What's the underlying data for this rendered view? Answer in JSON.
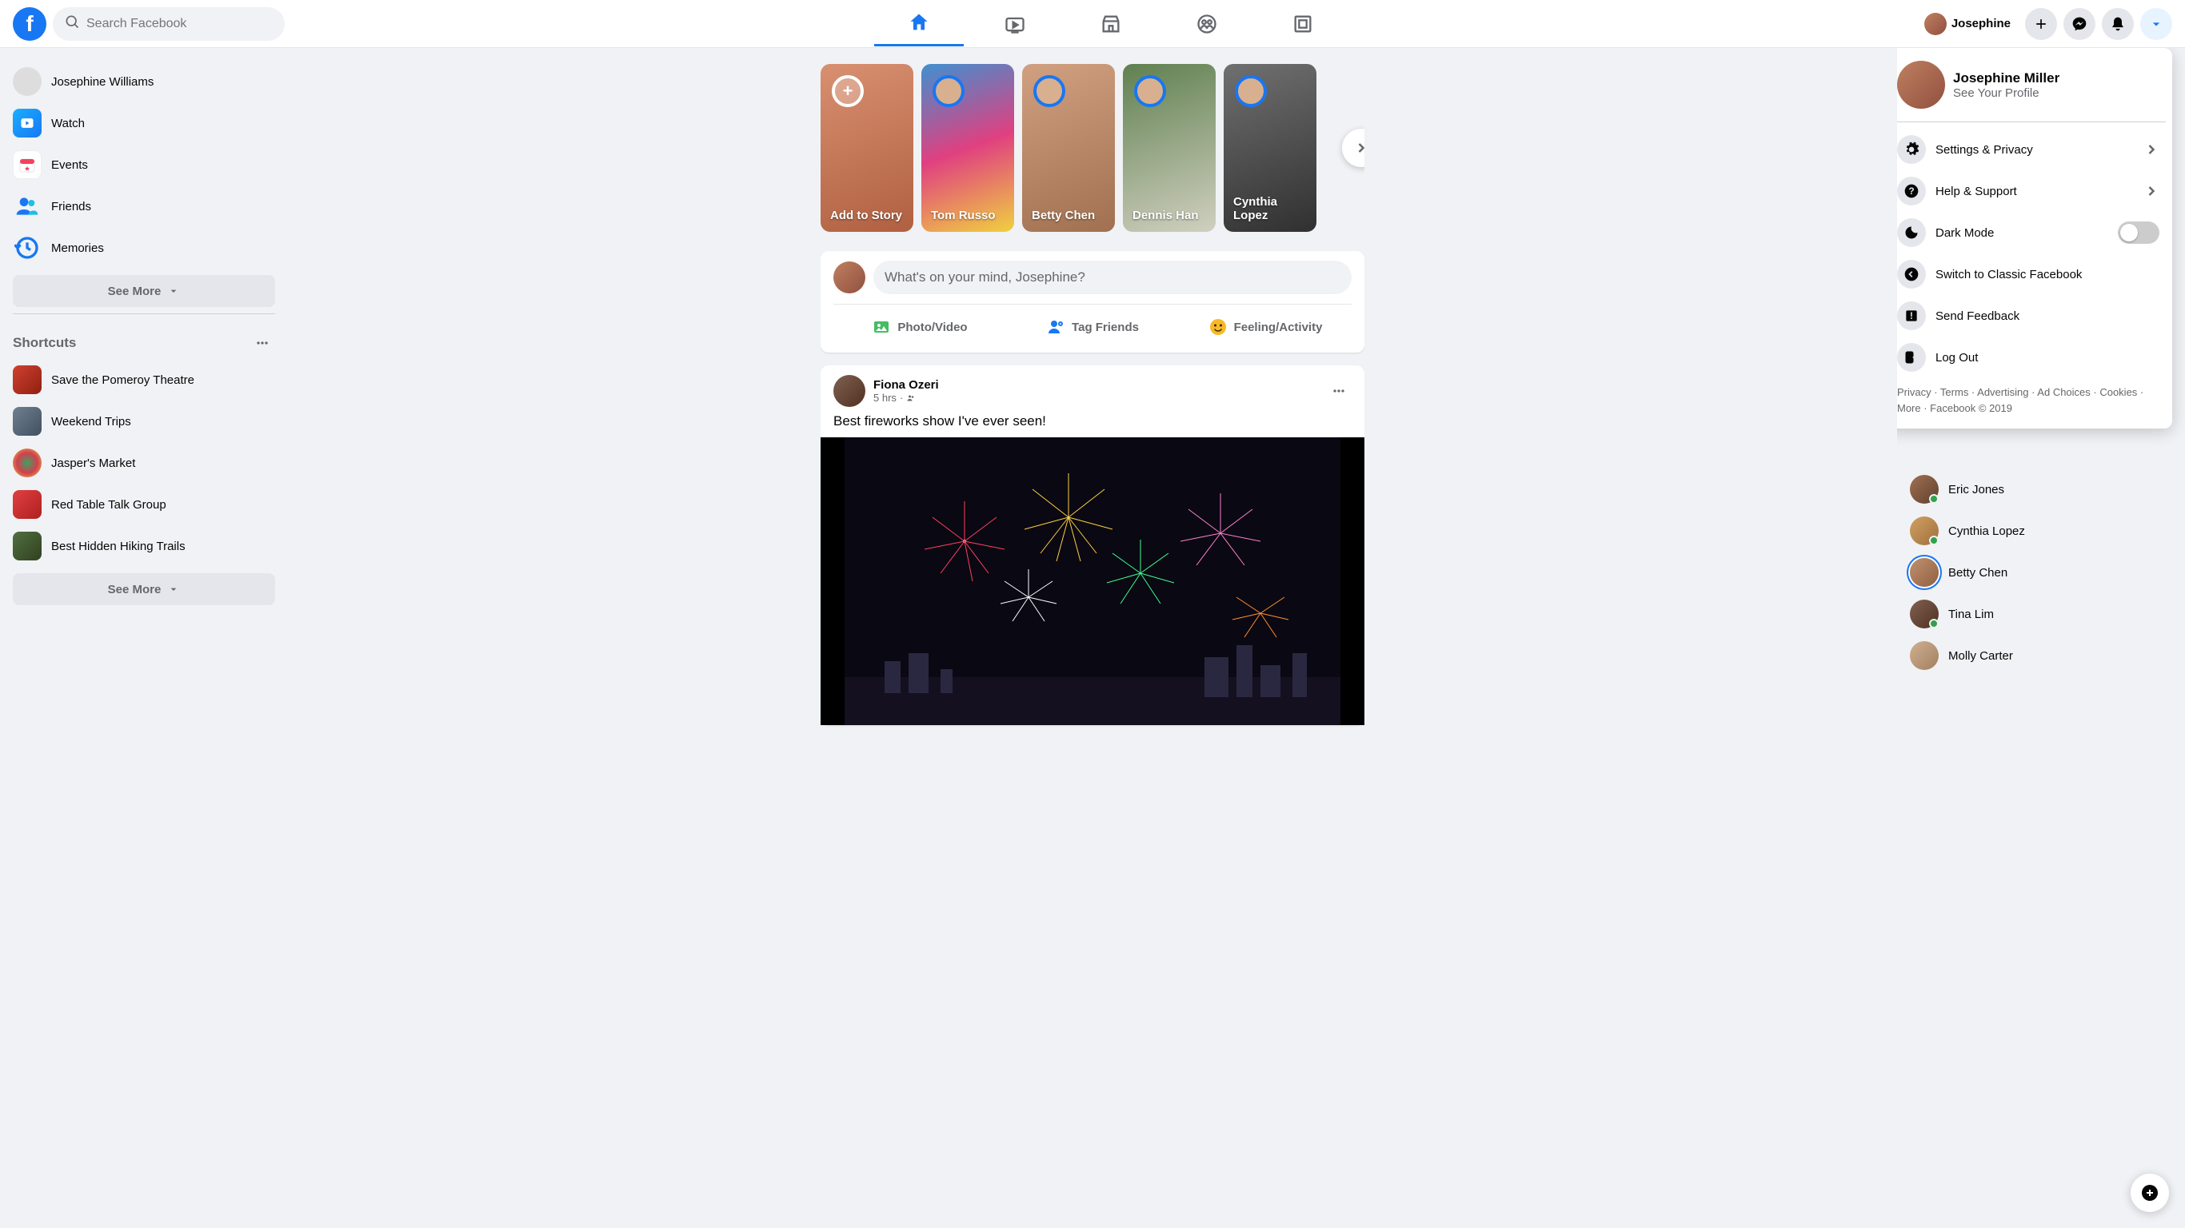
{
  "header": {
    "search_placeholder": "Search Facebook",
    "profile_name": "Josephine"
  },
  "left_sidebar": {
    "user_name": "Josephine Williams",
    "items": [
      {
        "label": "Watch"
      },
      {
        "label": "Events"
      },
      {
        "label": "Friends"
      },
      {
        "label": "Memories"
      }
    ],
    "see_more": "See More",
    "shortcuts_title": "Shortcuts",
    "shortcuts": [
      {
        "label": "Save the Pomeroy Theatre"
      },
      {
        "label": "Weekend Trips"
      },
      {
        "label": "Jasper's Market"
      },
      {
        "label": "Red Table Talk Group"
      },
      {
        "label": "Best Hidden Hiking Trails"
      }
    ],
    "see_more_2": "See More"
  },
  "stories": {
    "create_label": "Add to Story",
    "items": [
      {
        "name": "Tom Russo"
      },
      {
        "name": "Betty Chen"
      },
      {
        "name": "Dennis Han"
      },
      {
        "name": "Cynthia Lopez"
      }
    ]
  },
  "composer": {
    "placeholder": "What's on your mind, Josephine?",
    "photo_video": "Photo/Video",
    "tag_friends": "Tag Friends",
    "feeling_activity": "Feeling/Activity"
  },
  "post": {
    "author": "Fiona Ozeri",
    "time": "5 hrs",
    "body": "Best fireworks show I've ever seen!"
  },
  "dropdown": {
    "profile_name": "Josephine Miller",
    "profile_sub": "See Your Profile",
    "settings_privacy": "Settings & Privacy",
    "help_support": "Help & Support",
    "dark_mode": "Dark Mode",
    "switch_classic": "Switch to Classic Facebook",
    "send_feedback": "Send Feedback",
    "log_out": "Log Out",
    "footer": "Privacy · Terms · Advertising · Ad Choices · Cookies · More · Facebook © 2019"
  },
  "contacts": [
    {
      "name": "Eric Jones",
      "online": true
    },
    {
      "name": "Cynthia Lopez",
      "online": true
    },
    {
      "name": "Betty Chen",
      "ring": true
    },
    {
      "name": "Tina Lim",
      "online": true
    },
    {
      "name": "Molly Carter"
    }
  ]
}
